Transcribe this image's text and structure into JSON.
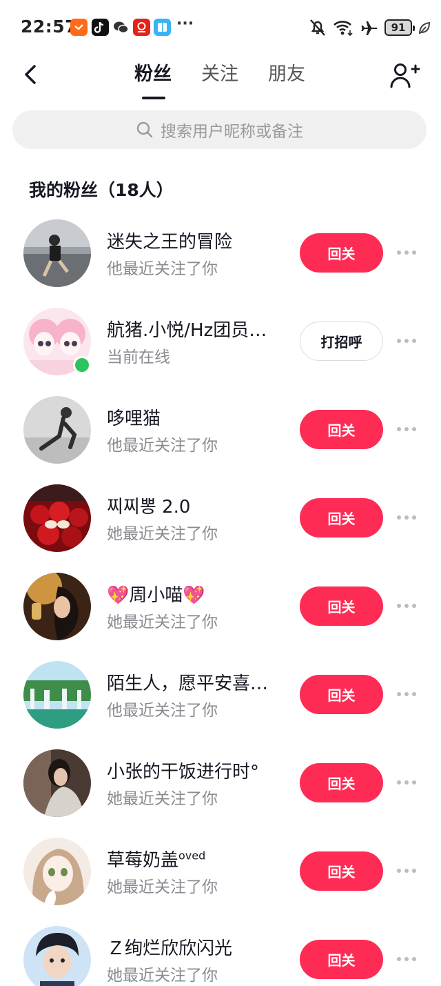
{
  "status_bar": {
    "time": "22:57",
    "battery": "91",
    "more_indicator": "···",
    "icons": [
      "taobao-icon",
      "tiktok-icon",
      "wechat-icon",
      "app-icon",
      "reader-icon",
      "mute-icon",
      "wifi-icon",
      "airplane-icon",
      "leaf-icon"
    ]
  },
  "header": {
    "tabs": [
      "粉丝",
      "关注",
      "朋友"
    ],
    "active_tab": "粉丝"
  },
  "search": {
    "placeholder": "搜索用户昵称或备注"
  },
  "section": {
    "title": "我的粉丝（18人）"
  },
  "followers": [
    {
      "name": "迷失之王的冒险",
      "status": "他最近关注了你",
      "button": "回关",
      "button_style": "primary",
      "online": false
    },
    {
      "name": "航猪.小悦/Hz团员…",
      "status": "当前在线",
      "button": "打招呼",
      "button_style": "secondary",
      "online": true
    },
    {
      "name": "哆哩猫",
      "status": "他最近关注了你",
      "button": "回关",
      "button_style": "primary",
      "online": false
    },
    {
      "name": "찌찌뽕 2.0",
      "status": "她最近关注了你",
      "button": "回关",
      "button_style": "primary",
      "online": false
    },
    {
      "name": "💖周小喵💖",
      "status": "她最近关注了你",
      "button": "回关",
      "button_style": "primary",
      "online": false
    },
    {
      "name": "陌生人，愿平安喜…",
      "status": "他最近关注了你",
      "button": "回关",
      "button_style": "primary",
      "online": false
    },
    {
      "name": "小张的干饭进行时°",
      "status": "她最近关注了你",
      "button": "回关",
      "button_style": "primary",
      "online": false
    },
    {
      "name": "草莓奶盖",
      "name_sup": "oved",
      "status": "她最近关注了你",
      "button": "回关",
      "button_style": "primary",
      "online": false
    },
    {
      "name": "Ｚ绚烂欣欣闪光",
      "status": "她最近关注了你",
      "button": "回关",
      "button_style": "primary",
      "online": false
    }
  ],
  "colors": {
    "accent": "#fe2c55",
    "online": "#2dc35d",
    "text_primary": "#161823",
    "text_secondary": "#8a8b91",
    "search_bg": "#f0f0f1"
  }
}
